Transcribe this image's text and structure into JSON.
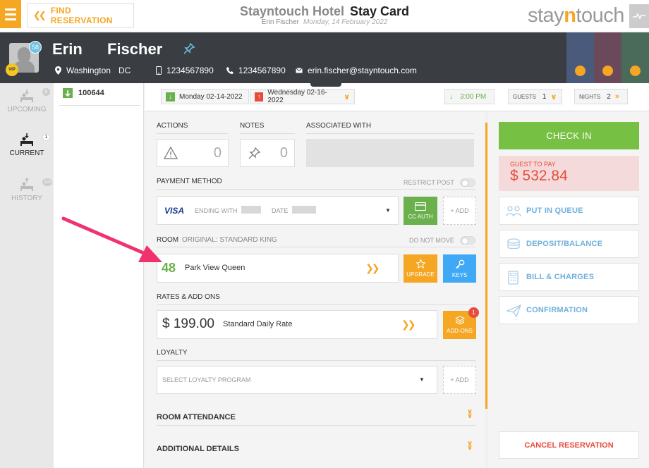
{
  "topbar": {
    "find_label": "FIND RESERVATION",
    "hotel_name": "Stayntouch Hotel",
    "page_name": "Stay Card",
    "guest_sub": "Erin Fischer",
    "date_sub": "Monday, 14 February 2022",
    "logo_pre": "stay",
    "logo_mid": "n",
    "logo_post": "touch"
  },
  "guest": {
    "first_name": "Erin",
    "last_name": "Fischer",
    "count_badge": "58",
    "vip": "VIP",
    "city": "Washington",
    "state": "DC",
    "phone1": "1234567890",
    "phone2": "1234567890",
    "email": "erin.fischer@stayntouch.com"
  },
  "nav": {
    "upcoming": "UPCOMING",
    "upcoming_count": "0",
    "current": "CURRENT",
    "current_count": "1",
    "history": "HISTORY",
    "history_count": "119"
  },
  "reservation": {
    "number": "100644",
    "arrival": "Monday 02-14-2022",
    "departure": "Wednesday 02-16-2022",
    "time": "3:00 PM",
    "guests_label": "GUESTS",
    "guests": "1",
    "nights_label": "NIGHTS",
    "nights": "2"
  },
  "sections": {
    "actions": "ACTIONS",
    "actions_count": "0",
    "notes": "NOTES",
    "notes_count": "0",
    "associated": "ASSOCIATED WITH",
    "payment_method": "PAYMENT METHOD",
    "restrict_post": "RESTRICT POST",
    "card_brand": "VISA",
    "ending_with": "ENDING WITH",
    "date_label": "DATE",
    "cc_auth": "CC AUTH",
    "add": "+ ADD",
    "room": "ROOM",
    "original": "ORIGINAL: STANDARD KING",
    "do_not_move": "DO NOT MOVE",
    "room_number": "48",
    "room_type": "Park View Queen",
    "upgrade": "UPGRADE",
    "keys": "KEYS",
    "rates": "RATES & ADD ONS",
    "rate_amount": "$ 199.00",
    "rate_name": "Standard Daily Rate",
    "addons": "ADD-ONS",
    "addons_count": "1",
    "loyalty": "LOYALTY",
    "loyalty_placeholder": "SELECT LOYALTY PROGRAM",
    "room_attendance": "ROOM ATTENDANCE",
    "additional_details": "ADDITIONAL DETAILS"
  },
  "right": {
    "check_in": "CHECK IN",
    "guest_to_pay_label": "GUEST TO PAY",
    "guest_to_pay": "$ 532.84",
    "put_in_queue": "PUT IN QUEUE",
    "deposit_balance": "DEPOSIT/BALANCE",
    "bill_charges": "BILL & CHARGES",
    "confirmation": "CONFIRMATION",
    "cancel": "CANCEL RESERVATION"
  },
  "colors": {
    "accent_orange": "#f5a623",
    "green": "#76c043",
    "red": "#e74c3c",
    "blue": "#6fb0dc",
    "header_dark": "#3a3d42",
    "annotation_pink": "#f0336f"
  }
}
